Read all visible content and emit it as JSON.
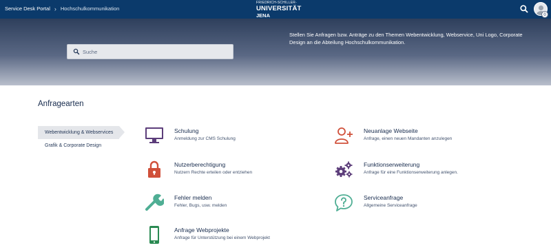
{
  "colors": {
    "topbar": "#0b3a6b",
    "purple": "#5c3d7a",
    "red": "#d0503a",
    "teal": "#4fae94",
    "green": "#2a8a52"
  },
  "topbar": {
    "breadcrumb": [
      "Service Desk Portal",
      "›",
      "Hochschulkommunikation"
    ],
    "logo": {
      "line1": "FRIEDRICH-SCHILLER-",
      "line2": "UNIVERSITÄT",
      "line3": "JENA"
    },
    "search_icon": "search-icon",
    "notification_count": "0"
  },
  "hero": {
    "search_placeholder": "Suche",
    "intro": "Stellen Sie Anfragen bzw. Anträge zu den Themen Webentwicklung, Webservice, Uni Logo, Corporate Design an die Abteilung Hochschulkommunikation."
  },
  "section_title": "Anfragearten",
  "sidebar": {
    "items": [
      {
        "label": "Webentwicklung & Webservices",
        "active": true
      },
      {
        "label": "Grafik & Corporate Design",
        "active": false
      }
    ]
  },
  "request_types": [
    {
      "icon": "monitor-icon",
      "title": "Schulung",
      "description": "Anmeldung zur CMS Schulung"
    },
    {
      "icon": "add-user-icon",
      "title": "Neuanlage Webseite",
      "description": "Anfrage, einen neuen Mandanten anzulegen"
    },
    {
      "icon": "lock-icon",
      "title": "Nutzerberechtigung",
      "description": "Nutzern Rechte erteilen oder entziehen"
    },
    {
      "icon": "gears-icon",
      "title": "Funktionserweiterung",
      "description": "Anfrage für eine Funktionserweiterung anlegen."
    },
    {
      "icon": "wrench-icon",
      "title": "Fehler melden",
      "description": "Fehler, Bugs, usw. melden"
    },
    {
      "icon": "question-bubble-icon",
      "title": "Serviceanfrage",
      "description": "Allgemeine Serviceanfrage"
    },
    {
      "icon": "smartphone-icon",
      "title": "Anfrage Webprojekte",
      "description": "Anfrage für Unterstützung bei einem Webprojekt"
    }
  ]
}
